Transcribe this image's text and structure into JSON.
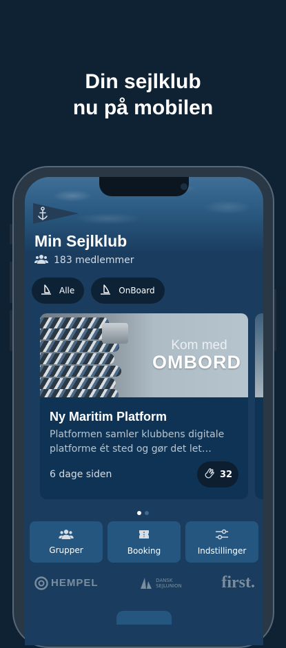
{
  "headline": {
    "line1": "Din sejlklub",
    "line2": "nu på mobilen"
  },
  "club": {
    "flag_icon": "anchor-icon",
    "title": "Min Sejlklub",
    "members_icon": "people-icon",
    "members_text": "183 medlemmer"
  },
  "filters": [
    {
      "label": "Alle",
      "icon": "sailboat-icon"
    },
    {
      "label": "OnBoard",
      "icon": "sailboat-icon"
    }
  ],
  "card": {
    "image_text_1": "Kom med",
    "image_text_2": "OMBORD",
    "title": "Ny Maritim Platform",
    "description": "Platformen samler klubbens digitale platforme ét sted og gør det let…",
    "date": "6 dage siden",
    "clap_icon": "clap-icon",
    "clap_count": "32"
  },
  "pagination": {
    "total": 2,
    "active": 1
  },
  "actions": [
    {
      "label": "Grupper",
      "icon": "people-icon"
    },
    {
      "label": "Booking",
      "icon": "ticket-icon"
    },
    {
      "label": "Indstillinger",
      "icon": "sliders-icon"
    }
  ],
  "sponsors": {
    "hempel": "HEMPEL",
    "dansk_line1": "DANSK",
    "dansk_line2": "SEJLUNION",
    "first": "first."
  },
  "colors": {
    "background": "#0f2234",
    "screen": "#1a3d5f",
    "card": "#0f3354",
    "action_tile": "#255680",
    "chip": "#0e2236"
  }
}
